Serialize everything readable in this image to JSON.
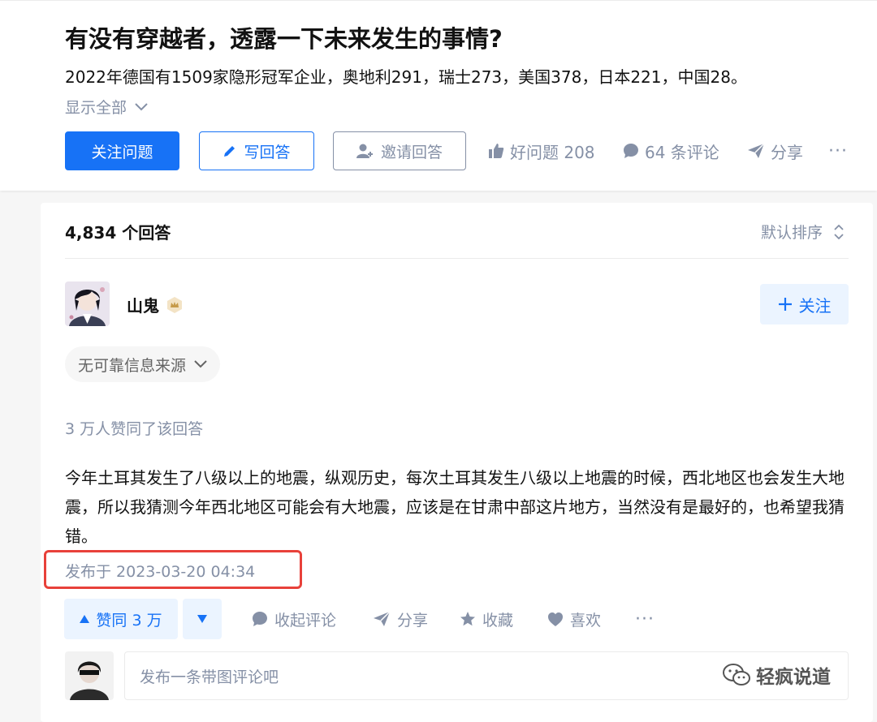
{
  "question": {
    "title": "有没有穿越者，透露一下未来发生的事情?",
    "description": "2022年德国有1509家隐形冠军企业，奥地利291，瑞士273，美国378，日本221，中国28。",
    "show_all": "显示全部",
    "actions": {
      "follow": "关注问题",
      "write": "写回答",
      "invite": "邀请回答",
      "good_question": "好问题 208",
      "comments": "64 条评论",
      "share": "分享",
      "more": "···"
    }
  },
  "answers": {
    "count_label": "4,834 个回答",
    "sort_label": "默认排序"
  },
  "answer": {
    "author": "山鬼",
    "follow_label": "关注",
    "source_label": "无可靠信息来源",
    "voters_label": "3 万人赞同了该回答",
    "content": "今年土耳其发生了八级以上的地震，纵观历史，每次土耳其发生八级以上地震的时候，西北地区也会发生大地震，所以我猜测今年西北地区可能会有大地震，应该是在甘肃中部这片地方，当然没有是最好的，也希望我猜错。",
    "published": "发布于 2023-03-20 04:34",
    "actions": {
      "upvote": "赞同 3 万",
      "collapse_comments": "收起评论",
      "share": "分享",
      "favorite": "收藏",
      "like": "喜欢",
      "more": "···"
    }
  },
  "comment_box": {
    "placeholder": "发布一条带图评论吧"
  },
  "watermark": "轻疯说道",
  "colors": {
    "brand_blue": "#1772f6",
    "muted_gray": "#8590a6",
    "highlight_red": "#e8413a"
  },
  "icons": [
    "chevron-down-icon",
    "pencil-icon",
    "add-user-icon",
    "thumbs-up-icon",
    "comment-bubble-icon",
    "share-plane-icon",
    "more-icon",
    "sort-icon",
    "badge-icon",
    "plus-icon",
    "triangle-up-icon",
    "triangle-down-icon",
    "star-icon",
    "heart-icon",
    "wechat-icon"
  ]
}
